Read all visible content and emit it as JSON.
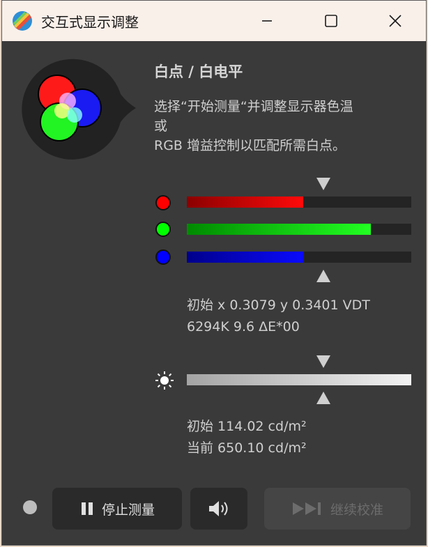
{
  "window": {
    "title": "交互式显示调整"
  },
  "section": {
    "heading": "白点 / 白电平",
    "description_lines": [
      "选择“开始测量“并调整显示器色温",
      "或",
      "RGB 增益控制以匹配所需白点。"
    ]
  },
  "rgb_gains": {
    "red": 0.52,
    "green": 0.82,
    "blue": 0.52,
    "target": 0.61
  },
  "whitepoint_readout": {
    "line1": "初始 x 0.3079 y 0.3401 VDT",
    "line2": "6294K 9.6 ΔE*00"
  },
  "luminance": {
    "target": 0.61
  },
  "luminance_readout": {
    "line1": "初始 114.02 cd/m²",
    "line2": "当前 650.10 cd/m²"
  },
  "buttons": {
    "stop_label": "停止测量",
    "continue_label": "继续校准"
  },
  "icons": {
    "minimize": "minimize-icon",
    "maximize": "maximize-icon",
    "close": "close-icon",
    "brightness": "sun-icon",
    "pause": "pause-icon",
    "speaker": "speaker-icon",
    "skip": "skip-forward-icon"
  },
  "colors": {
    "red": "#ff0000",
    "green": "#00ff00",
    "blue": "#0000ff",
    "status": "#bdbdbd"
  }
}
